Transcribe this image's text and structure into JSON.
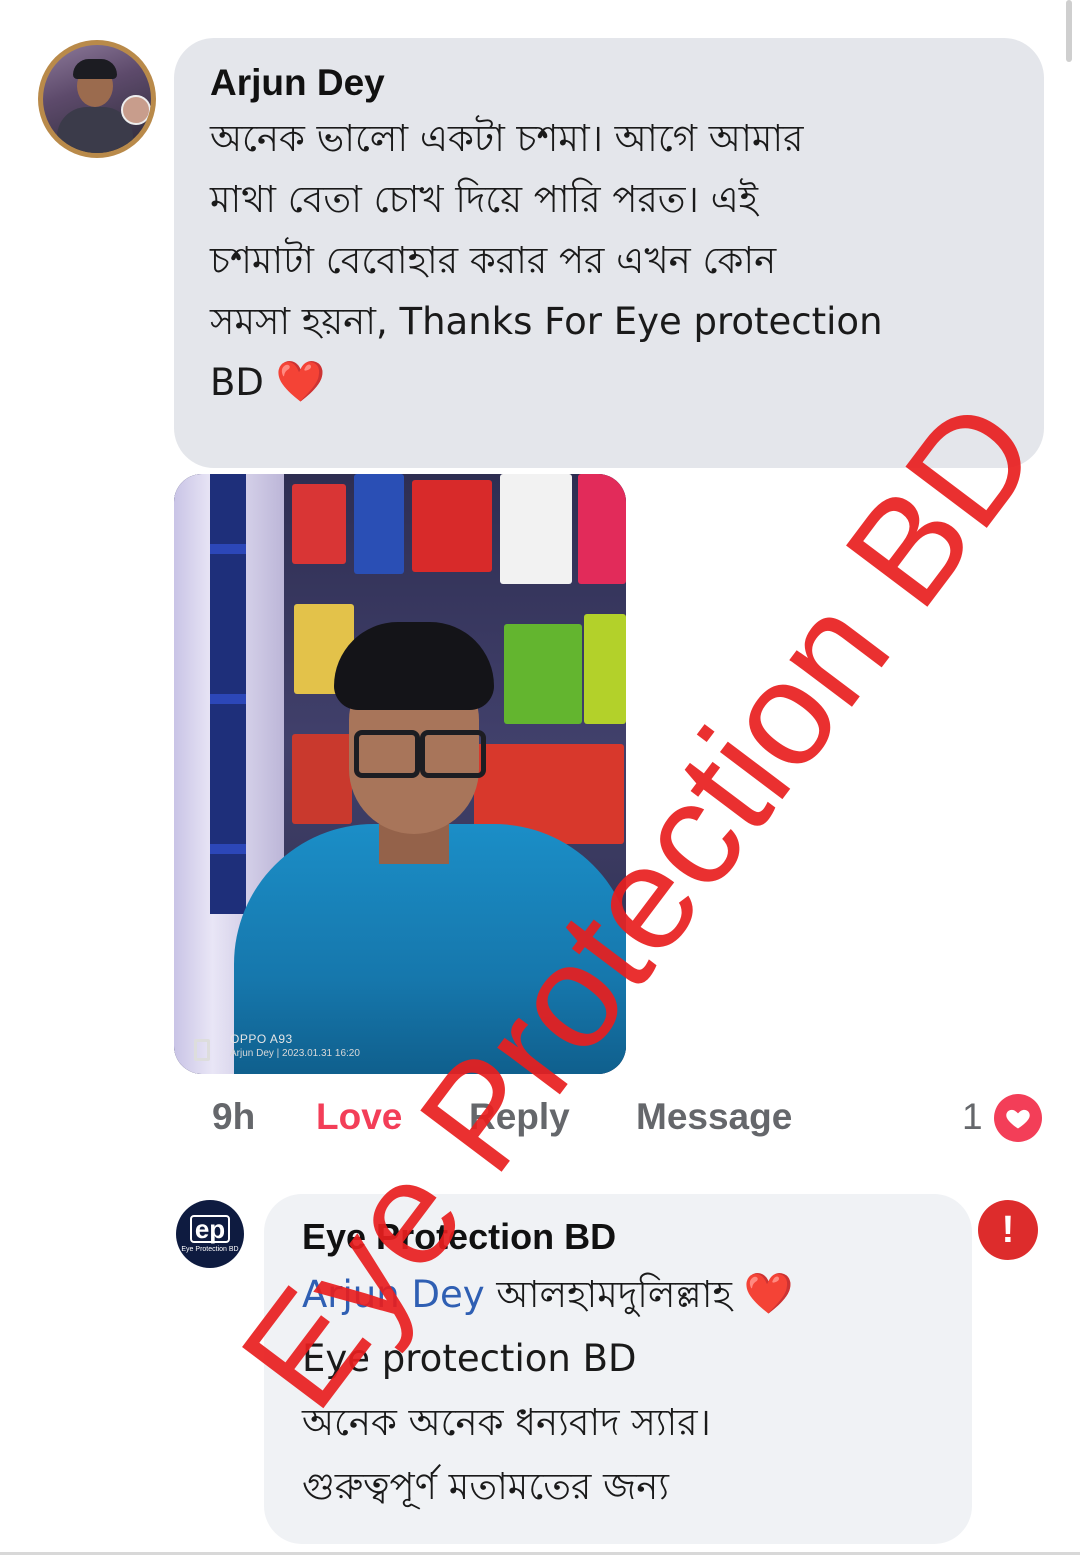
{
  "comment": {
    "author": "Arjun Dey",
    "lines": [
      "অনেক ভালো একটা চশমা।  আগে আমার",
      "মাথা বেতা চোখ দিয়ে পারি পরত। এই",
      "চশমাটা বেবোহার করার পর এখন কোন",
      "সমসা হয়না, Thanks For Eye protection",
      "BD"
    ],
    "emoji": "❤️"
  },
  "photo": {
    "camera": "OPPO A93",
    "caption": "Arjun Dey  |  2023.01.31 16:20"
  },
  "actions": {
    "time": "9h",
    "love": "Love",
    "reply": "Reply",
    "message": "Message",
    "reaction_count": "1"
  },
  "reply": {
    "author": "Eye Protection BD",
    "mention": "Arjun Dey",
    "line1_rest": " আলহামদুলিল্লাহ ",
    "emoji": "❤️",
    "line2": " Eye protection BD",
    "line3": "অনেক অনেক ধন্যবাদ স্যার।",
    "line4": "গুরুত্বপূর্ণ মতামতের জন্য",
    "avatar_logo": "ep",
    "avatar_sub": "Eye Protection BD",
    "alert_icon": "!"
  },
  "watermark": "Eye Protection BD",
  "colors": {
    "bubble": "#e4e6eb",
    "love": "#f33e58",
    "mention": "#2f5fb3",
    "watermark": "#e81e1e"
  }
}
